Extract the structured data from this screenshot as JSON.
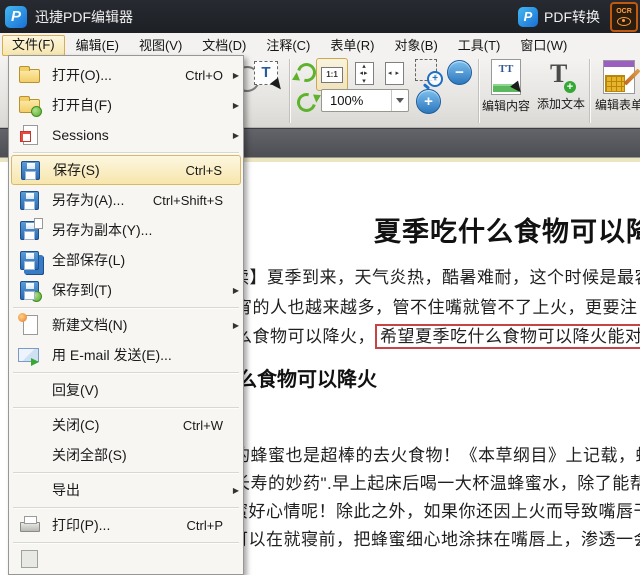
{
  "titlebar": {
    "app_title": "迅捷PDF编辑器",
    "logo_letter": "P",
    "pdf_convert_label": "PDF转换",
    "ocr_text": "OCR"
  },
  "menubar": {
    "items": [
      {
        "key": "file",
        "label": "文件(F)",
        "active": true
      },
      {
        "key": "edit",
        "label": "编辑(E)",
        "active": false
      },
      {
        "key": "view",
        "label": "视图(V)",
        "active": false
      },
      {
        "key": "document",
        "label": "文档(D)",
        "active": false
      },
      {
        "key": "comment",
        "label": "注释(C)",
        "active": false
      },
      {
        "key": "form",
        "label": "表单(R)",
        "active": false
      },
      {
        "key": "object",
        "label": "对象(B)",
        "active": false
      },
      {
        "key": "tools",
        "label": "工具(T)",
        "active": false
      },
      {
        "key": "window",
        "label": "窗口(W)",
        "active": false
      }
    ]
  },
  "file_menu": {
    "items": [
      {
        "key": "open",
        "icon": "folder-open",
        "label": "打开(O)...",
        "shortcut": "Ctrl+O",
        "submenu": true,
        "highlight": false,
        "sep_after": false
      },
      {
        "key": "open-from",
        "icon": "folder-globe",
        "label": "打开自(F)",
        "shortcut": "",
        "submenu": true,
        "highlight": false,
        "sep_after": false
      },
      {
        "key": "sessions",
        "icon": "sessions",
        "label": "Sessions",
        "shortcut": "",
        "submenu": true,
        "highlight": false,
        "sep_after": true
      },
      {
        "key": "save",
        "icon": "floppy",
        "label": "保存(S)",
        "shortcut": "Ctrl+S",
        "submenu": false,
        "highlight": true,
        "sep_after": false
      },
      {
        "key": "save-as",
        "icon": "floppy-saveas",
        "label": "另存为(A)...",
        "shortcut": "Ctrl+Shift+S",
        "submenu": false,
        "highlight": false,
        "sep_after": false
      },
      {
        "key": "save-copy",
        "icon": "floppy-copy",
        "label": "另存为副本(Y)...",
        "shortcut": "",
        "submenu": false,
        "highlight": false,
        "sep_after": false
      },
      {
        "key": "save-all",
        "icon": "floppy-all",
        "label": "全部保存(L)",
        "shortcut": "",
        "submenu": false,
        "highlight": false,
        "sep_after": false
      },
      {
        "key": "save-to",
        "icon": "floppy-globe",
        "label": "保存到(T)",
        "shortcut": "",
        "submenu": true,
        "highlight": false,
        "sep_after": true
      },
      {
        "key": "new-doc",
        "icon": "new-doc",
        "label": "新建文档(N)",
        "shortcut": "",
        "submenu": true,
        "highlight": false,
        "sep_after": false
      },
      {
        "key": "email",
        "icon": "email",
        "label": "用 E-mail 发送(E)...",
        "shortcut": "",
        "submenu": false,
        "highlight": false,
        "sep_after": true
      },
      {
        "key": "revert",
        "icon": "none",
        "label": "回复(V)",
        "shortcut": "",
        "submenu": false,
        "highlight": false,
        "sep_after": true
      },
      {
        "key": "close",
        "icon": "none",
        "label": "关闭(C)",
        "shortcut": "Ctrl+W",
        "submenu": false,
        "highlight": false,
        "sep_after": false
      },
      {
        "key": "close-all",
        "icon": "none",
        "label": "关闭全部(S)",
        "shortcut": "",
        "submenu": false,
        "highlight": false,
        "sep_after": true
      },
      {
        "key": "export",
        "icon": "none",
        "label": "导出",
        "shortcut": "",
        "submenu": true,
        "highlight": false,
        "sep_after": true
      },
      {
        "key": "print",
        "icon": "printer",
        "label": "打印(P)...",
        "shortcut": "Ctrl+P",
        "submenu": false,
        "highlight": false,
        "sep_after": true
      },
      {
        "key": "clipped-item",
        "icon": "partial",
        "label": "",
        "shortcut": "",
        "submenu": false,
        "highlight": false,
        "sep_after": false
      }
    ]
  },
  "toolbar": {
    "zoom_level": "100%",
    "one_to_one_label": "1:1",
    "edit_content_label": "编辑内容",
    "add_text_label": "添加文本",
    "edit_form_label": "编辑表单"
  },
  "document": {
    "title": "夏季吃什么食物可以降",
    "para1_line1": "读】夏季到来，天气炎热，酷暑难耐，这个时候是最容",
    "para1_line2": "宵的人也越来越多，管不住嘴就管不了上火，更要注",
    "para1_line3_prefix": "么食物可以降火，",
    "para1_line3_boxed": "希望夏季吃什么食物可以降火能对您",
    "subheading": "么食物可以降火",
    "para2_line1": "的蜂蜜也是超棒的去火食物！《本草纲目》上记载，蜂",
    "para2_line2": "长寿的妙药\".早上起床后喝一大杯温蜂蜜水，除了能帮",
    "para2_line3": "蜜好心情呢！除此之外，如果你还因上火而导致嘴唇干",
    "para2_line4": "可以在就寝前，把蜂蜜细心地涂抹在嘴唇上，渗透一会"
  },
  "colors": {
    "titlebar_bg": "#22252b",
    "accent_blue": "#1f6fc4",
    "menu_highlight": "#f7e6ac",
    "menu_highlight_border": "#d9b965",
    "green_accent": "#5fb32c",
    "red_box": "#c84343",
    "ocr_orange": "#ff9e3d"
  }
}
